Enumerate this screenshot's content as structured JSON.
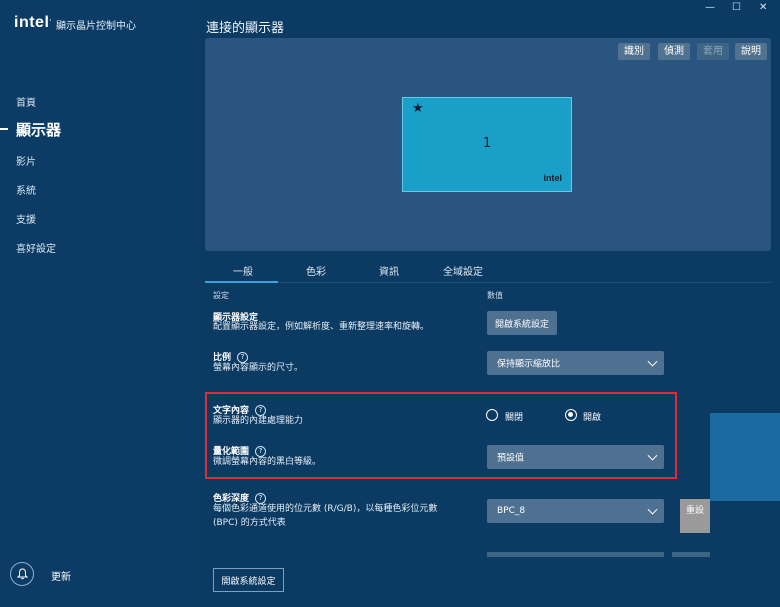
{
  "app": {
    "logo": "intel",
    "title": "顯示晶片控制中心"
  },
  "sidebar": {
    "items": [
      {
        "label": "首頁"
      },
      {
        "label": "顯示器"
      },
      {
        "label": "影片"
      },
      {
        "label": "系統"
      },
      {
        "label": "支援"
      },
      {
        "label": "喜好設定"
      }
    ],
    "update_label": "更新"
  },
  "page": {
    "title": "連接的顯示器",
    "toolbar": {
      "identify": "識別",
      "detect": "偵測",
      "apply": "套用",
      "help": "說明"
    },
    "monitor": {
      "number": "1",
      "brand": "intel"
    }
  },
  "tabs": [
    {
      "label": "一般",
      "active": true
    },
    {
      "label": "色彩"
    },
    {
      "label": "資訊"
    },
    {
      "label": "全域設定"
    }
  ],
  "columns": {
    "setting": "設定",
    "value": "數值"
  },
  "settings": {
    "display": {
      "title": "顯示器設定",
      "desc": "配置顯示器設定，例如解析度、重新整理速率和旋轉。",
      "button": "開啟系統設定"
    },
    "scale": {
      "title": "比例",
      "desc": "螢幕內容顯示的尺寸。",
      "value": "保持顯示縮放比"
    },
    "text": {
      "title": "文字內容",
      "desc": "顯示器的內建處理能力",
      "off": "關閉",
      "on": "開啟",
      "selected": "on"
    },
    "quant": {
      "title": "量化範圍",
      "desc": "微調螢幕內容的黑白等級。",
      "value": "預設值"
    },
    "depth": {
      "title": "色彩深度",
      "desc_1": "每個色彩通道使用的位元數 (R/G/B)，以每種色彩位元數",
      "desc_2": "(BPC) 的方式代表",
      "value": "BPC_8",
      "reset": "重設"
    }
  },
  "footer_button": "開啟系統設定",
  "colors": {
    "accent": "#3aa1dd",
    "highlight_border": "#e02b36",
    "monitor": "#1aa0c8"
  },
  "icons": [
    "bell-icon",
    "star-icon",
    "help-icon",
    "chevron-down-icon",
    "minimize-icon",
    "maximize-icon",
    "close-icon"
  ]
}
